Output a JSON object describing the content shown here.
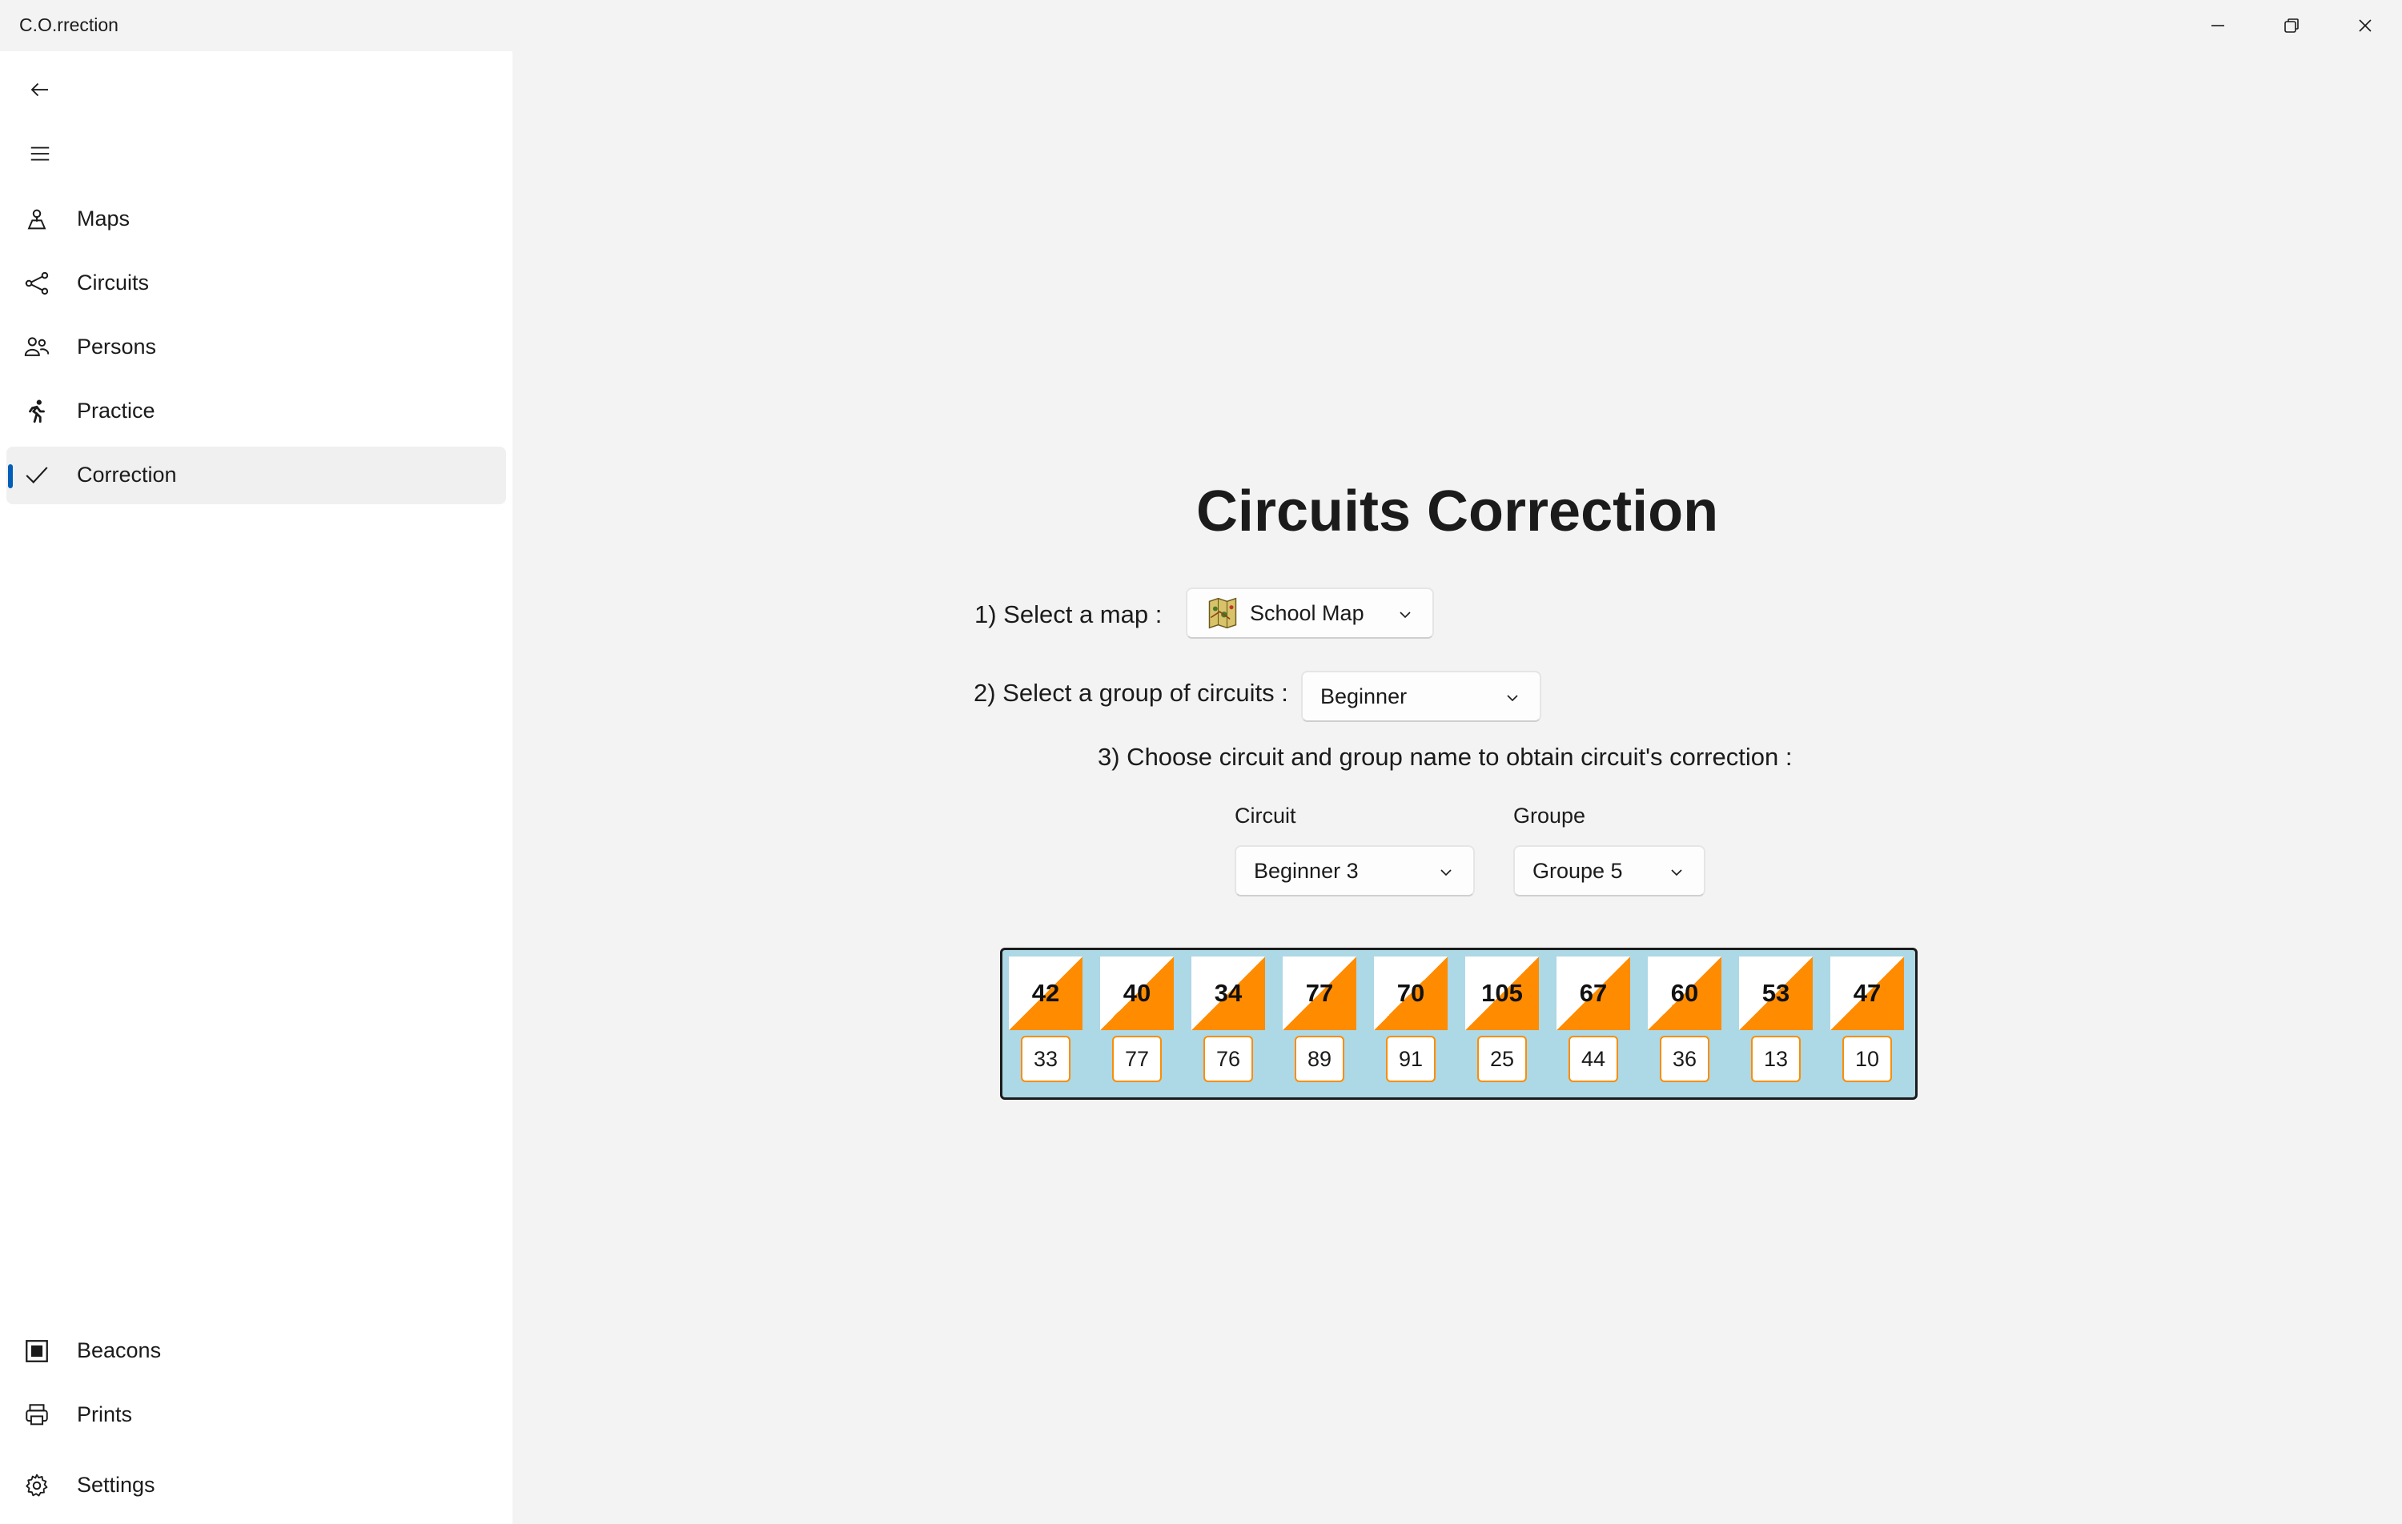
{
  "window": {
    "title": "C.O.rrection"
  },
  "sidebar": {
    "items": [
      {
        "label": "Maps",
        "icon": "map-pin-icon"
      },
      {
        "label": "Circuits",
        "icon": "share-nodes-icon"
      },
      {
        "label": "Persons",
        "icon": "people-icon"
      },
      {
        "label": "Practice",
        "icon": "running-person-icon"
      },
      {
        "label": "Correction",
        "icon": "checkmark-icon",
        "selected": true
      }
    ],
    "footer_items": [
      {
        "label": "Beacons",
        "icon": "beacon-square-icon"
      },
      {
        "label": "Prints",
        "icon": "printer-icon"
      },
      {
        "label": "Settings",
        "icon": "gear-icon"
      }
    ]
  },
  "main": {
    "title": "Circuits Correction",
    "step1": {
      "label": "1) Select a map :",
      "value": "School Map"
    },
    "step2": {
      "label": "2) Select a group of circuits :",
      "value": "Beginner"
    },
    "step3": {
      "label": "3) Choose circuit and group name to obtain circuit's correction :"
    },
    "circuit": {
      "label": "Circuit",
      "value": "Beginner 3"
    },
    "group": {
      "label": "Groupe",
      "value": "Groupe 5"
    },
    "correction": [
      {
        "beacon": "42",
        "answer": "33"
      },
      {
        "beacon": "40",
        "answer": "77"
      },
      {
        "beacon": "34",
        "answer": "76"
      },
      {
        "beacon": "77",
        "answer": "89"
      },
      {
        "beacon": "70",
        "answer": "91"
      },
      {
        "beacon": "105",
        "answer": "25"
      },
      {
        "beacon": "67",
        "answer": "44"
      },
      {
        "beacon": "60",
        "answer": "36"
      },
      {
        "beacon": "53",
        "answer": "13"
      },
      {
        "beacon": "47",
        "answer": "10"
      }
    ]
  },
  "colors": {
    "accent": "#005fb8",
    "beacon_orange": "#ff8c00",
    "strip_background": "#add8e6"
  }
}
